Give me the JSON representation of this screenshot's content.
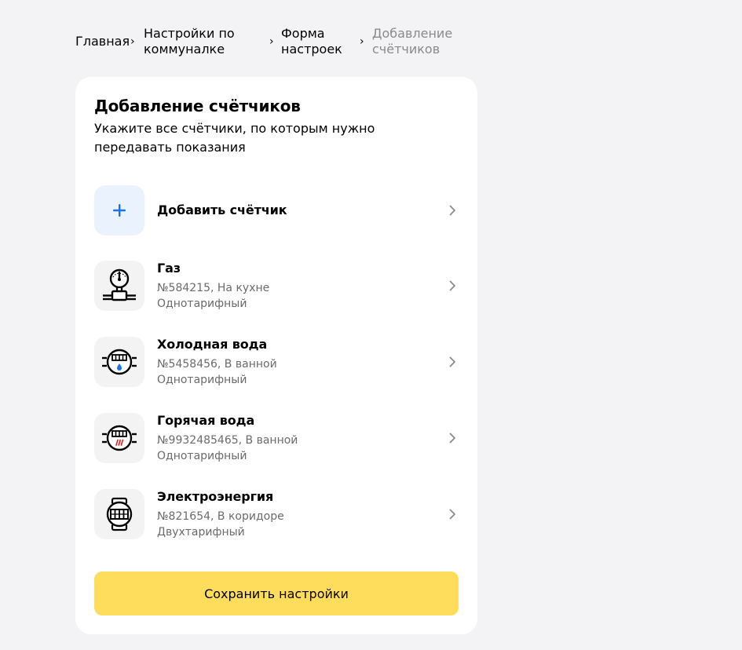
{
  "breadcrumb": {
    "items": [
      {
        "label": "Главная"
      },
      {
        "label_l1": "Настройки по",
        "label_l2": "коммуналке"
      },
      {
        "label_l1": "Форма",
        "label_l2": "настроек"
      },
      {
        "label_l1": "Добавление",
        "label_l2": "счётчиков"
      }
    ],
    "separator": "›"
  },
  "card": {
    "title": "Добавление счётчиков",
    "subtitle": "Укажите все счётчики, по которым нужно передавать показания",
    "add_meter_label": "Добавить счётчик",
    "meters": [
      {
        "title": "Газ",
        "line1": "№584215, На кухне",
        "line2": "Однотарифный",
        "icon": "gas-meter-icon"
      },
      {
        "title": "Холодная вода",
        "line1": "№5458456, В ванной",
        "line2": "Однотарифный",
        "icon": "cold-water-meter-icon"
      },
      {
        "title": "Горячая вода",
        "line1": "№9932485465, В ванной",
        "line2": "Однотарифный",
        "icon": "hot-water-meter-icon"
      },
      {
        "title": "Электроэнергия",
        "line1": "№821654, В коридоре",
        "line2": "Двухтарифный",
        "icon": "electricity-meter-icon"
      }
    ],
    "save_label": "Сохранить настройки"
  },
  "colors": {
    "background": "#f3f3f5",
    "card": "#ffffff",
    "accent_blue": "#1a73e8",
    "add_icon_bg": "#eaf2fe",
    "save_button": "#fddd5b",
    "muted_text": "#6b6b6b",
    "water_drop": "#1a73e8",
    "hot_marks": "#e02020"
  }
}
